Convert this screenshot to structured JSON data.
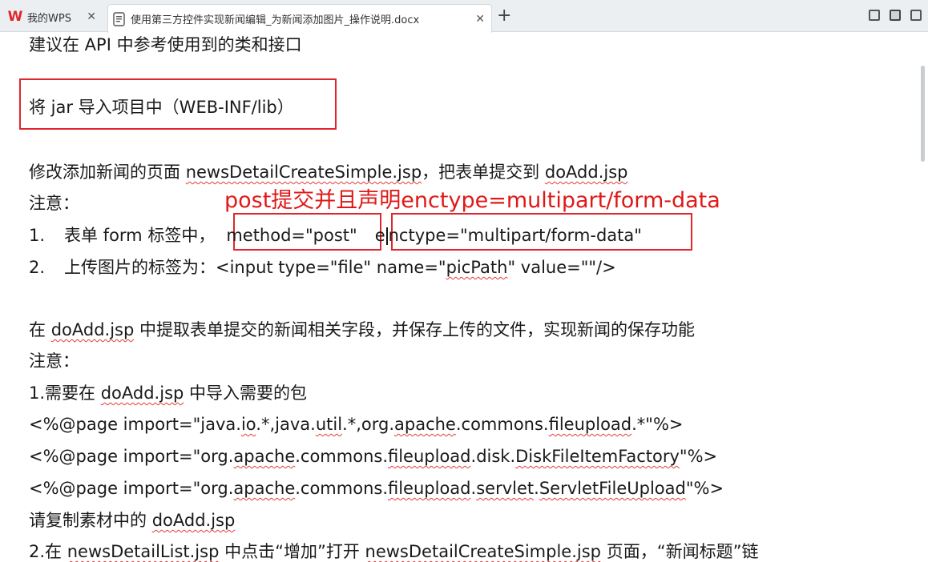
{
  "tabs": {
    "wps_label": "我的WPS",
    "doc_label": "使用第三方控件实现新闻编辑_为新闻添加图片_操作说明.docx",
    "close_glyph": "✕",
    "new_tab_glyph": "+"
  },
  "document": {
    "l1": "建议在 API 中参考使用到的类和接口",
    "l2": "将 jar 导入项目中（WEB-INF/lib）",
    "l3a": "修改添加新闻的页面 ",
    "l3b": "newsDetailCreateSimple.jsp",
    "l3c": "，把表单提交到 ",
    "l3d": "doAdd.jsp",
    "l4": "注意：",
    "l5num": "1.",
    "l5a": "表单 form 标签中，",
    "l5b": "method=\"post\"",
    "l5c": "e",
    "l5d": "nctype=\"multipart/form-data\"",
    "l6num": "2.",
    "l6a": "上传图片的标签为：<input type=\"file\" name=\"",
    "l6b": "picPath",
    "l6c": "\" value=\"\"/>",
    "l7a": "在 ",
    "l7b": "doAdd.jsp",
    "l7c": " 中提取表单提交的新闻相关字段，并保存上传的文件，实现新闻的保存功能",
    "l8": "注意：",
    "l9a": "1.需要在 ",
    "l9b": "doAdd.jsp",
    "l9c": " 中导入需要的包",
    "l10a": "<%@page import=\"java.",
    "l10b": "io",
    "l10c": ".*,java.",
    "l10d": "util",
    "l10e": ".*,org.",
    "l10f": "apache",
    "l10g": ".commons.",
    "l10h": "fileupload",
    "l10i": ".*\"%>",
    "l11a": "<%@page import=\"org.",
    "l11b": "apache",
    "l11c": ".commons.",
    "l11d": "fileupload",
    "l11e": ".disk.",
    "l11f": "DiskFileItemFactory",
    "l11g": "\"%>",
    "l12a": "<%@page import=\"org.",
    "l12b": "apache",
    "l12c": ".commons.",
    "l12d": "fileupload",
    "l12e": ".",
    "l12f": "servlet",
    "l12g": ".",
    "l12h": "ServletFileUpload",
    "l12i": "\"%>",
    "l13a": "请复制素材中的 ",
    "l13b": "doAdd.jsp",
    "l14a": "2.在 ",
    "l14b": "newsDetailList.jsp",
    "l14c": " 中点击“增加”打开 ",
    "l14d": "newsDetailCreateSimple.jsp",
    "l14e": " 页面，“新闻标题”链"
  },
  "annotation": {
    "text": "post提交并且声明enctype=multipart/form-data",
    "color": "#e01818"
  },
  "colors": {
    "box": "#e0262b",
    "spell_underline": "#e23b3b",
    "wps_red": "#e0262b"
  }
}
